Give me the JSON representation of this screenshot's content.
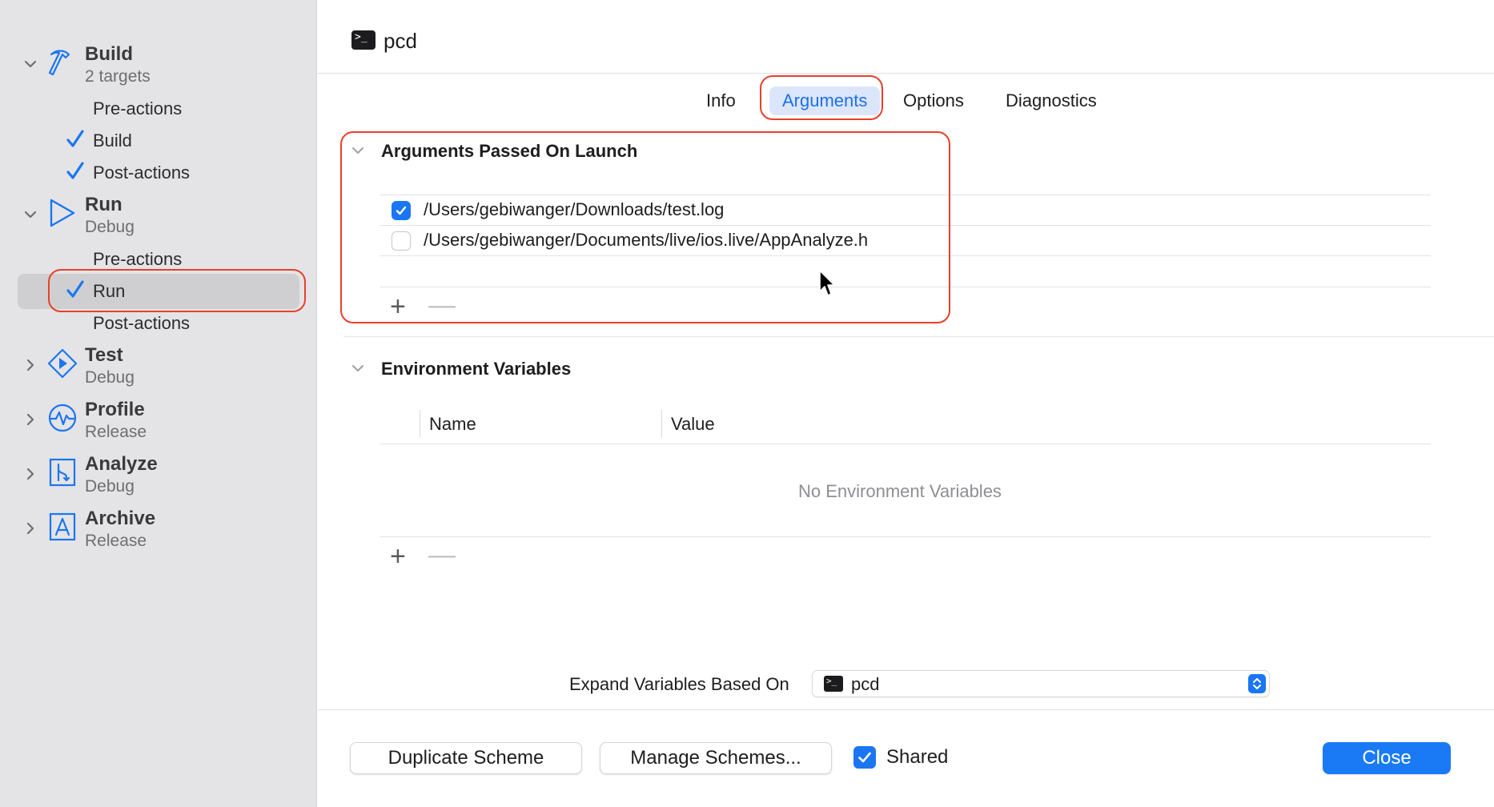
{
  "sidebar": {
    "groups": [
      {
        "title": "Build",
        "subtitle": "2 targets",
        "icon": "hammer-icon",
        "expanded": true,
        "steps": [
          {
            "label": "Pre-actions",
            "checked": false
          },
          {
            "label": "Build",
            "checked": true
          },
          {
            "label": "Post-actions",
            "checked": true
          }
        ]
      },
      {
        "title": "Run",
        "subtitle": "Debug",
        "icon": "play-icon",
        "expanded": true,
        "steps": [
          {
            "label": "Pre-actions",
            "checked": false
          },
          {
            "label": "Run",
            "checked": true,
            "selected": true
          },
          {
            "label": "Post-actions",
            "checked": false
          }
        ]
      },
      {
        "title": "Test",
        "subtitle": "Debug",
        "icon": "test-diamond-icon",
        "expanded": false
      },
      {
        "title": "Profile",
        "subtitle": "Release",
        "icon": "gauge-icon",
        "expanded": false
      },
      {
        "title": "Analyze",
        "subtitle": "Debug",
        "icon": "analyze-icon",
        "expanded": false
      },
      {
        "title": "Archive",
        "subtitle": "Release",
        "icon": "archive-icon",
        "expanded": false
      }
    ]
  },
  "header": {
    "title": "pcd",
    "icon": "terminal-icon",
    "icon_glyph": ">_"
  },
  "tabs": [
    {
      "label": "Info",
      "active": false
    },
    {
      "label": "Arguments",
      "active": true
    },
    {
      "label": "Options",
      "active": false
    },
    {
      "label": "Diagnostics",
      "active": false
    }
  ],
  "arguments": {
    "section_title": "Arguments Passed On Launch",
    "items": [
      {
        "value": "/Users/gebiwanger/Downloads/test.log",
        "enabled": true
      },
      {
        "value": "/Users/gebiwanger/Documents/live/ios.live/AppAnalyze.h",
        "enabled": false
      }
    ],
    "add_label": "+",
    "remove_label": "—"
  },
  "environment": {
    "section_title": "Environment Variables",
    "columns": [
      "Name",
      "Value"
    ],
    "empty_text": "No Environment Variables",
    "add_label": "+",
    "remove_label": "—"
  },
  "expand": {
    "label": "Expand Variables Based On",
    "value": "pcd"
  },
  "footer": {
    "duplicate_label": "Duplicate Scheme",
    "manage_label": "Manage Schemes...",
    "shared_label": "Shared",
    "shared_checked": true,
    "close_label": "Close"
  },
  "colors": {
    "accent": "#1a76f2",
    "highlight": "#e8402a",
    "icon_blue": "#1a76f2"
  }
}
